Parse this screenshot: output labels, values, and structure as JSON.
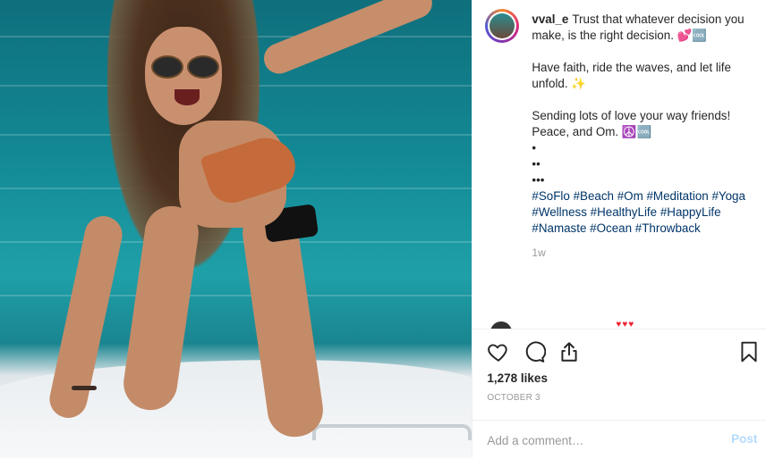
{
  "post": {
    "username": "vval_e",
    "caption_line1": "Trust that whatever decision you make, is the right decision. 💕🆒",
    "caption_para2": "Have faith, ride the waves, and let life unfold. ✨",
    "caption_para3a": "Sending lots of love your way friends!",
    "caption_para3b": "Peace, and Om. ☮️🆒",
    "dots1": "•",
    "dots2": "••",
    "dots3": "•••",
    "hashtags": [
      "#SoFlo",
      "#Beach",
      "#Om",
      "#Meditation",
      "#Yoga",
      "#Wellness",
      "#HealthyLife",
      "#HappyLife",
      "#Namaste",
      "#Ocean",
      "#Throwback"
    ],
    "time_ago": "1w",
    "likes": "1,278 likes",
    "date": "OCTOBER 3"
  },
  "comment": {
    "placeholder": "Add a comment…",
    "post_label": "Post"
  },
  "icons": {
    "like": "heart-icon",
    "comment": "comment-icon",
    "share": "share-icon",
    "save": "bookmark-icon"
  }
}
